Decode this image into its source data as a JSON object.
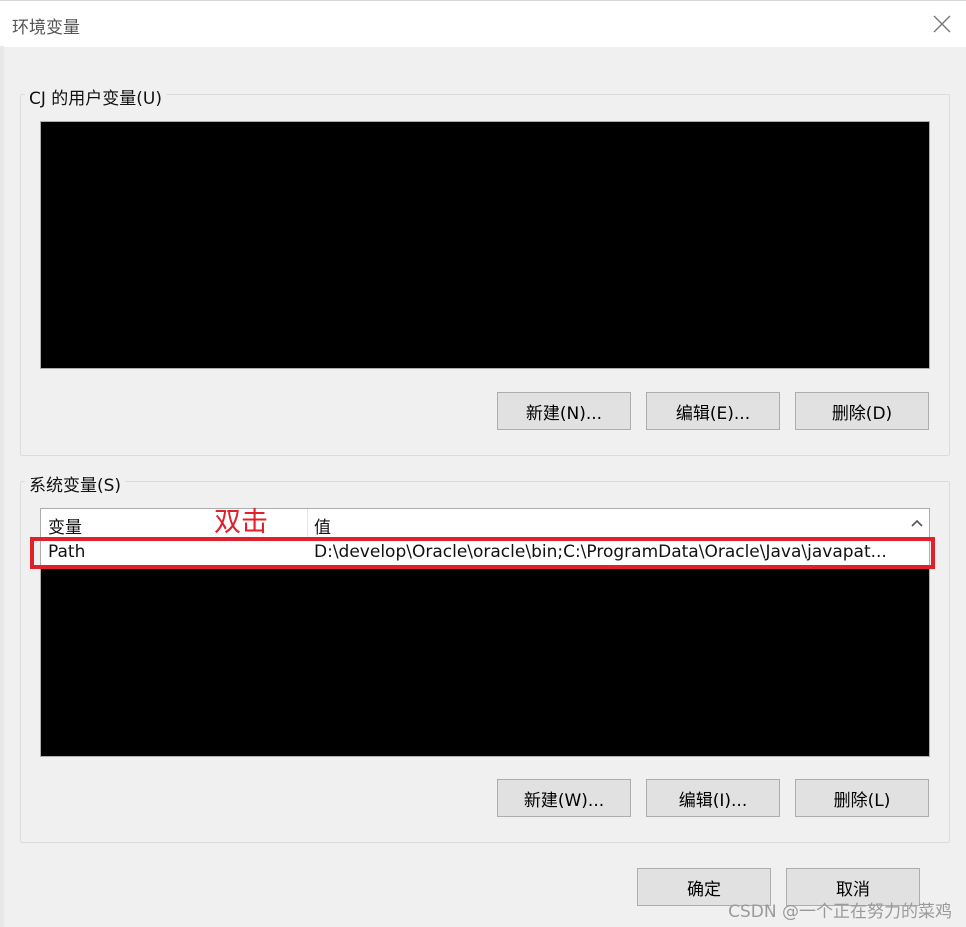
{
  "window": {
    "title": "环境变量",
    "close_icon": "close-icon"
  },
  "user_vars": {
    "label": "CJ 的用户变量(U)",
    "buttons": {
      "new": "新建(N)...",
      "edit": "编辑(E)...",
      "delete": "删除(D)"
    }
  },
  "system_vars": {
    "label": "系统变量(S)",
    "columns": {
      "variable": "变量",
      "value": "值"
    },
    "rows": [
      {
        "variable": "Path",
        "value": "D:\\develop\\Oracle\\oracle\\bin;C:\\ProgramData\\Oracle\\Java\\javapat..."
      }
    ],
    "buttons": {
      "new": "新建(W)...",
      "edit": "编辑(I)...",
      "delete": "删除(L)"
    }
  },
  "footer": {
    "ok": "确定",
    "cancel": "取消"
  },
  "annotation": {
    "text": "双击",
    "color": "#e0202a"
  },
  "watermark": "CSDN @一个正在努力的菜鸡"
}
